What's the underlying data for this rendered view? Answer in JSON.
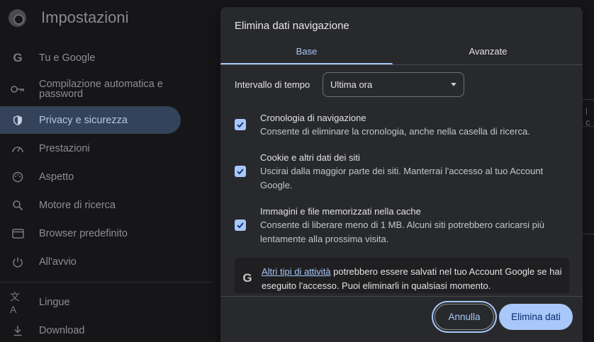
{
  "settings": {
    "title": "Impostazioni",
    "sidebar": {
      "items": [
        {
          "label": "Tu e Google",
          "icon": "google-g-icon"
        },
        {
          "label": "Compilazione automatica e password",
          "icon": "key-icon"
        },
        {
          "label": "Privacy e sicurezza",
          "icon": "shield-icon",
          "active": true
        },
        {
          "label": "Prestazioni",
          "icon": "speedometer-icon"
        },
        {
          "label": "Aspetto",
          "icon": "palette-icon"
        },
        {
          "label": "Motore di ricerca",
          "icon": "search-icon"
        },
        {
          "label": "Browser predefinito",
          "icon": "browser-window-icon"
        },
        {
          "label": "All'avvio",
          "icon": "power-icon"
        },
        {
          "label": "Lingue",
          "icon": "translate-icon"
        },
        {
          "label": "Download",
          "icon": "download-icon"
        }
      ]
    },
    "right_fragment": "l c"
  },
  "dialog": {
    "title": "Elimina dati navigazione",
    "tabs": {
      "base": "Base",
      "advanced": "Avanzate"
    },
    "time_range": {
      "label": "Intervallo di tempo",
      "value": "Ultima ora"
    },
    "options": [
      {
        "title": "Cronologia di navigazione",
        "description": "Consente di eliminare la cronologia, anche nella casella di ricerca.",
        "checked": true
      },
      {
        "title": "Cookie e altri dati dei siti",
        "description": "Uscirai dalla maggior parte dei siti. Manterrai l'accesso al tuo Account Google.",
        "checked": true
      },
      {
        "title": "Immagini e file memorizzati nella cache",
        "description": "Consente di liberare meno di 1 MB. Alcuni siti potrebbero caricarsi più lentamente alla prossima visita.",
        "checked": true
      }
    ],
    "info": {
      "link": "Altri tipi di attività",
      "text": " potrebbero essere salvati nel tuo Account Google se hai eseguito l'accesso. Puoi eliminarli in qualsiasi momento."
    },
    "buttons": {
      "cancel": "Annulla",
      "confirm": "Elimina dati"
    }
  },
  "colors": {
    "accent": "#a8c7fa",
    "dialog_bg": "#28292c",
    "active_nav": "#34425a"
  }
}
